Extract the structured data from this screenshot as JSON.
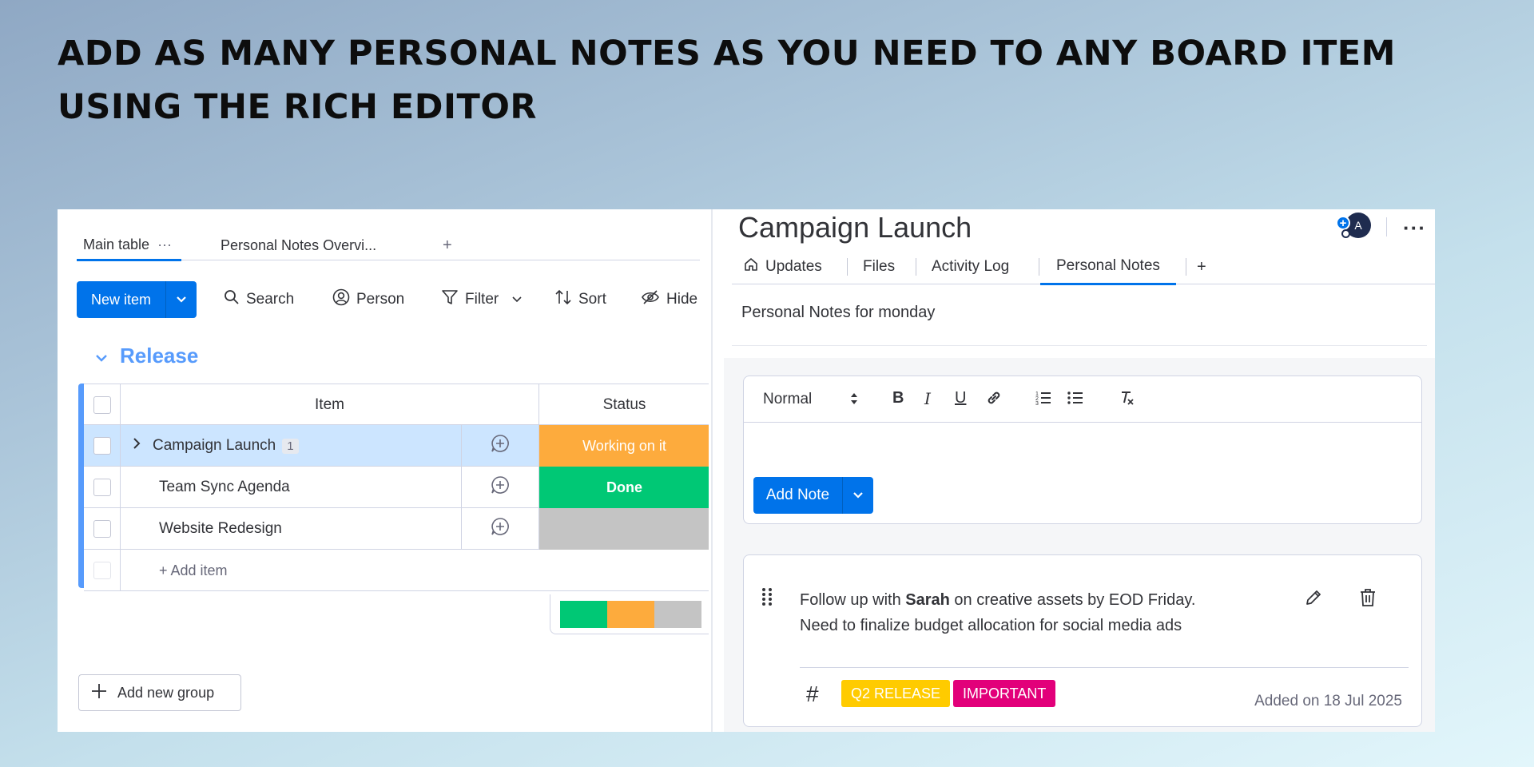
{
  "headline": "ADD AS MANY PERSONAL NOTES AS YOU NEED TO ANY BOARD ITEM USING THE RICH EDITOR",
  "board": {
    "tabs": [
      {
        "label": "Main table",
        "more": "···"
      },
      {
        "label": "Personal Notes Overvi..."
      }
    ],
    "tab_add": "+",
    "toolbar": {
      "new_item": "New item",
      "search": "Search",
      "person": "Person",
      "filter": "Filter",
      "sort": "Sort",
      "hide": "Hide"
    },
    "group": {
      "name": "Release",
      "color": "#579bfc"
    },
    "columns": {
      "item": "Item",
      "status": "Status"
    },
    "rows": [
      {
        "name": "Campaign Launch",
        "count": "1",
        "status": "Working on it",
        "status_color": "#fdab3d"
      },
      {
        "name": "Team Sync Agenda",
        "status": "Done",
        "status_color": "#00c875"
      },
      {
        "name": "Website Redesign",
        "status": "",
        "status_color": "#c4c4c4"
      }
    ],
    "add_item": "+ Add item",
    "summary": [
      {
        "color": "#00c875",
        "fraction": 0.333
      },
      {
        "color": "#fdab3d",
        "fraction": 0.333
      },
      {
        "color": "#c4c4c4",
        "fraction": 0.334
      }
    ],
    "add_group": "Add new group"
  },
  "panel": {
    "title": "Campaign Launch",
    "avatar_initial": "A",
    "more": "···",
    "tabs": [
      "Updates",
      "Files",
      "Activity Log",
      "Personal Notes"
    ],
    "active_tab": "Personal Notes",
    "tab_add": "+",
    "subtitle": "Personal Notes for monday",
    "editor": {
      "style_select": "Normal",
      "add_note": "Add Note"
    },
    "note": {
      "text_before": "Follow up with ",
      "text_bold": "Sarah",
      "text_after": " on creative assets by EOD Friday.",
      "text_line2": "Need to finalize budget allocation for social media ads",
      "hash": "#",
      "tags": [
        {
          "label": "Q2 RELEASE",
          "color": "#ffcb00"
        },
        {
          "label": "IMPORTANT",
          "color": "#e2007a"
        }
      ],
      "added": "Added on 18 Jul 2025"
    }
  }
}
